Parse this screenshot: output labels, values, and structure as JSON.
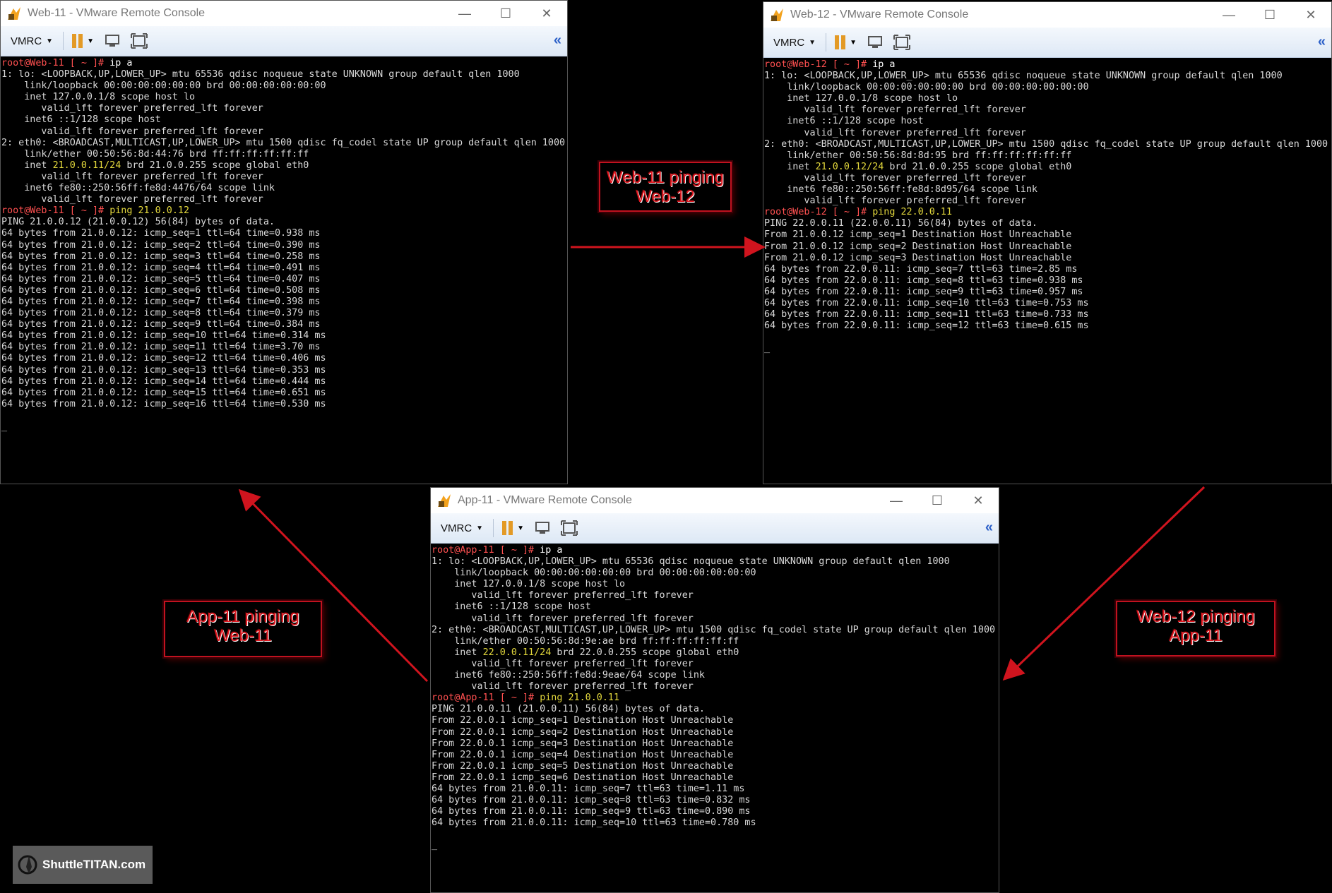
{
  "windows": [
    {
      "title": "Web-11 - VMware Remote Console",
      "toolbar_label": "VMRC",
      "terminal": [
        [
          [
            "r",
            "root@Web-11 [ ~ ]# "
          ],
          [
            "w",
            "ip a"
          ]
        ],
        [
          [
            "d",
            "1: lo: <LOOPBACK,UP,LOWER_UP> mtu 65536 qdisc noqueue state UNKNOWN group default qlen 1000"
          ]
        ],
        [
          [
            "d",
            "    link/loopback 00:00:00:00:00:00 brd 00:00:00:00:00:00"
          ]
        ],
        [
          [
            "d",
            "    inet 127.0.0.1/8 scope host lo"
          ]
        ],
        [
          [
            "d",
            "       valid_lft forever preferred_lft forever"
          ]
        ],
        [
          [
            "d",
            "    inet6 ::1/128 scope host"
          ]
        ],
        [
          [
            "d",
            "       valid_lft forever preferred_lft forever"
          ]
        ],
        [
          [
            "d",
            "2: eth0: <BROADCAST,MULTICAST,UP,LOWER_UP> mtu 1500 qdisc fq_codel state UP group default qlen 1000"
          ]
        ],
        [
          [
            "d",
            "    link/ether 00:50:56:8d:44:76 brd ff:ff:ff:ff:ff:ff"
          ]
        ],
        [
          [
            "d",
            "    inet "
          ],
          [
            "y",
            "21.0.0.11/24"
          ],
          [
            "d",
            " brd 21.0.0.255 scope global eth0"
          ]
        ],
        [
          [
            "d",
            "       valid_lft forever preferred_lft forever"
          ]
        ],
        [
          [
            "d",
            "    inet6 fe80::250:56ff:fe8d:4476/64 scope link"
          ]
        ],
        [
          [
            "d",
            "       valid_lft forever preferred_lft forever"
          ]
        ],
        [
          [
            "r",
            "root@Web-11 [ ~ ]# "
          ],
          [
            "y",
            "ping 21.0.0.12"
          ]
        ],
        [
          [
            "d",
            "PING 21.0.0.12 (21.0.0.12) 56(84) bytes of data."
          ]
        ],
        [
          [
            "d",
            "64 bytes from 21.0.0.12: icmp_seq=1 ttl=64 time=0.938 ms"
          ]
        ],
        [
          [
            "d",
            "64 bytes from 21.0.0.12: icmp_seq=2 ttl=64 time=0.390 ms"
          ]
        ],
        [
          [
            "d",
            "64 bytes from 21.0.0.12: icmp_seq=3 ttl=64 time=0.258 ms"
          ]
        ],
        [
          [
            "d",
            "64 bytes from 21.0.0.12: icmp_seq=4 ttl=64 time=0.491 ms"
          ]
        ],
        [
          [
            "d",
            "64 bytes from 21.0.0.12: icmp_seq=5 ttl=64 time=0.407 ms"
          ]
        ],
        [
          [
            "d",
            "64 bytes from 21.0.0.12: icmp_seq=6 ttl=64 time=0.508 ms"
          ]
        ],
        [
          [
            "d",
            "64 bytes from 21.0.0.12: icmp_seq=7 ttl=64 time=0.398 ms"
          ]
        ],
        [
          [
            "d",
            "64 bytes from 21.0.0.12: icmp_seq=8 ttl=64 time=0.379 ms"
          ]
        ],
        [
          [
            "d",
            "64 bytes from 21.0.0.12: icmp_seq=9 ttl=64 time=0.384 ms"
          ]
        ],
        [
          [
            "d",
            "64 bytes from 21.0.0.12: icmp_seq=10 ttl=64 time=0.314 ms"
          ]
        ],
        [
          [
            "d",
            "64 bytes from 21.0.0.12: icmp_seq=11 ttl=64 time=3.70 ms"
          ]
        ],
        [
          [
            "d",
            "64 bytes from 21.0.0.12: icmp_seq=12 ttl=64 time=0.406 ms"
          ]
        ],
        [
          [
            "d",
            "64 bytes from 21.0.0.12: icmp_seq=13 ttl=64 time=0.353 ms"
          ]
        ],
        [
          [
            "d",
            "64 bytes from 21.0.0.12: icmp_seq=14 ttl=64 time=0.444 ms"
          ]
        ],
        [
          [
            "d",
            "64 bytes from 21.0.0.12: icmp_seq=15 ttl=64 time=0.651 ms"
          ]
        ],
        [
          [
            "d",
            "64 bytes from 21.0.0.12: icmp_seq=16 ttl=64 time=0.530 ms"
          ]
        ],
        [
          [
            "d",
            ""
          ]
        ],
        [
          [
            "d",
            "_"
          ]
        ]
      ]
    },
    {
      "title": "Web-12 - VMware Remote Console",
      "toolbar_label": "VMRC",
      "terminal": [
        [
          [
            "r",
            "root@Web-12 [ ~ ]# "
          ],
          [
            "w",
            "ip a"
          ]
        ],
        [
          [
            "d",
            "1: lo: <LOOPBACK,UP,LOWER_UP> mtu 65536 qdisc noqueue state UNKNOWN group default qlen 1000"
          ]
        ],
        [
          [
            "d",
            "    link/loopback 00:00:00:00:00:00 brd 00:00:00:00:00:00"
          ]
        ],
        [
          [
            "d",
            "    inet 127.0.0.1/8 scope host lo"
          ]
        ],
        [
          [
            "d",
            "       valid_lft forever preferred_lft forever"
          ]
        ],
        [
          [
            "d",
            "    inet6 ::1/128 scope host"
          ]
        ],
        [
          [
            "d",
            "       valid_lft forever preferred_lft forever"
          ]
        ],
        [
          [
            "d",
            "2: eth0: <BROADCAST,MULTICAST,UP,LOWER_UP> mtu 1500 qdisc fq_codel state UP group default qlen 1000"
          ]
        ],
        [
          [
            "d",
            "    link/ether 00:50:56:8d:8d:95 brd ff:ff:ff:ff:ff:ff"
          ]
        ],
        [
          [
            "d",
            "    inet "
          ],
          [
            "y",
            "21.0.0.12/24"
          ],
          [
            "d",
            " brd 21.0.0.255 scope global eth0"
          ]
        ],
        [
          [
            "d",
            "       valid_lft forever preferred_lft forever"
          ]
        ],
        [
          [
            "d",
            "    inet6 fe80::250:56ff:fe8d:8d95/64 scope link"
          ]
        ],
        [
          [
            "d",
            "       valid_lft forever preferred_lft forever"
          ]
        ],
        [
          [
            "r",
            "root@Web-12 [ ~ ]# "
          ],
          [
            "y",
            "ping 22.0.0.11"
          ]
        ],
        [
          [
            "d",
            "PING 22.0.0.11 (22.0.0.11) 56(84) bytes of data."
          ]
        ],
        [
          [
            "d",
            "From 21.0.0.12 icmp_seq=1 Destination Host Unreachable"
          ]
        ],
        [
          [
            "d",
            "From 21.0.0.12 icmp_seq=2 Destination Host Unreachable"
          ]
        ],
        [
          [
            "d",
            "From 21.0.0.12 icmp_seq=3 Destination Host Unreachable"
          ]
        ],
        [
          [
            "d",
            "64 bytes from 22.0.0.11: icmp_seq=7 ttl=63 time=2.85 ms"
          ]
        ],
        [
          [
            "d",
            "64 bytes from 22.0.0.11: icmp_seq=8 ttl=63 time=0.938 ms"
          ]
        ],
        [
          [
            "d",
            "64 bytes from 22.0.0.11: icmp_seq=9 ttl=63 time=0.957 ms"
          ]
        ],
        [
          [
            "d",
            "64 bytes from 22.0.0.11: icmp_seq=10 ttl=63 time=0.753 ms"
          ]
        ],
        [
          [
            "d",
            "64 bytes from 22.0.0.11: icmp_seq=11 ttl=63 time=0.733 ms"
          ]
        ],
        [
          [
            "d",
            "64 bytes from 22.0.0.11: icmp_seq=12 ttl=63 time=0.615 ms"
          ]
        ],
        [
          [
            "d",
            ""
          ]
        ],
        [
          [
            "d",
            "_"
          ]
        ]
      ]
    },
    {
      "title": "App-11 - VMware Remote Console",
      "toolbar_label": "VMRC",
      "terminal": [
        [
          [
            "r",
            "root@App-11 [ ~ ]# "
          ],
          [
            "w",
            "ip a"
          ]
        ],
        [
          [
            "d",
            "1: lo: <LOOPBACK,UP,LOWER_UP> mtu 65536 qdisc noqueue state UNKNOWN group default qlen 1000"
          ]
        ],
        [
          [
            "d",
            "    link/loopback 00:00:00:00:00:00 brd 00:00:00:00:00:00"
          ]
        ],
        [
          [
            "d",
            "    inet 127.0.0.1/8 scope host lo"
          ]
        ],
        [
          [
            "d",
            "       valid_lft forever preferred_lft forever"
          ]
        ],
        [
          [
            "d",
            "    inet6 ::1/128 scope host"
          ]
        ],
        [
          [
            "d",
            "       valid_lft forever preferred_lft forever"
          ]
        ],
        [
          [
            "d",
            "2: eth0: <BROADCAST,MULTICAST,UP,LOWER_UP> mtu 1500 qdisc fq_codel state UP group default qlen 1000"
          ]
        ],
        [
          [
            "d",
            "    link/ether 00:50:56:8d:9e:ae brd ff:ff:ff:ff:ff:ff"
          ]
        ],
        [
          [
            "d",
            "    inet "
          ],
          [
            "y",
            "22.0.0.11/24"
          ],
          [
            "d",
            " brd 22.0.0.255 scope global eth0"
          ]
        ],
        [
          [
            "d",
            "       valid_lft forever preferred_lft forever"
          ]
        ],
        [
          [
            "d",
            "    inet6 fe80::250:56ff:fe8d:9eae/64 scope link"
          ]
        ],
        [
          [
            "d",
            "       valid_lft forever preferred_lft forever"
          ]
        ],
        [
          [
            "r",
            "root@App-11 [ ~ ]# "
          ],
          [
            "y",
            "ping 21.0.0.11"
          ]
        ],
        [
          [
            "d",
            "PING 21.0.0.11 (21.0.0.11) 56(84) bytes of data."
          ]
        ],
        [
          [
            "d",
            "From 22.0.0.1 icmp_seq=1 Destination Host Unreachable"
          ]
        ],
        [
          [
            "d",
            "From 22.0.0.1 icmp_seq=2 Destination Host Unreachable"
          ]
        ],
        [
          [
            "d",
            "From 22.0.0.1 icmp_seq=3 Destination Host Unreachable"
          ]
        ],
        [
          [
            "d",
            "From 22.0.0.1 icmp_seq=4 Destination Host Unreachable"
          ]
        ],
        [
          [
            "d",
            "From 22.0.0.1 icmp_seq=5 Destination Host Unreachable"
          ]
        ],
        [
          [
            "d",
            "From 22.0.0.1 icmp_seq=6 Destination Host Unreachable"
          ]
        ],
        [
          [
            "d",
            "64 bytes from 21.0.0.11: icmp_seq=7 ttl=63 time=1.11 ms"
          ]
        ],
        [
          [
            "d",
            "64 bytes from 21.0.0.11: icmp_seq=8 ttl=63 time=0.832 ms"
          ]
        ],
        [
          [
            "d",
            "64 bytes from 21.0.0.11: icmp_seq=9 ttl=63 time=0.890 ms"
          ]
        ],
        [
          [
            "d",
            "64 bytes from 21.0.0.11: icmp_seq=10 ttl=63 time=0.780 ms"
          ]
        ],
        [
          [
            "d",
            ""
          ]
        ],
        [
          [
            "d",
            "_"
          ]
        ]
      ]
    }
  ],
  "annotations": {
    "web11_label": [
      "Web-11 pinging",
      "Web-12"
    ],
    "app11_label": [
      "App-11 pinging",
      "Web-11"
    ],
    "web12_label": [
      "Web-12 pinging",
      "App-11"
    ]
  },
  "logo_text": "ShuttleTITAN.com",
  "colors": {
    "prompt": "#ff5050",
    "highlight": "#e3d83c",
    "arrow": "#d0141e",
    "toolbar": "#dde8f5"
  }
}
